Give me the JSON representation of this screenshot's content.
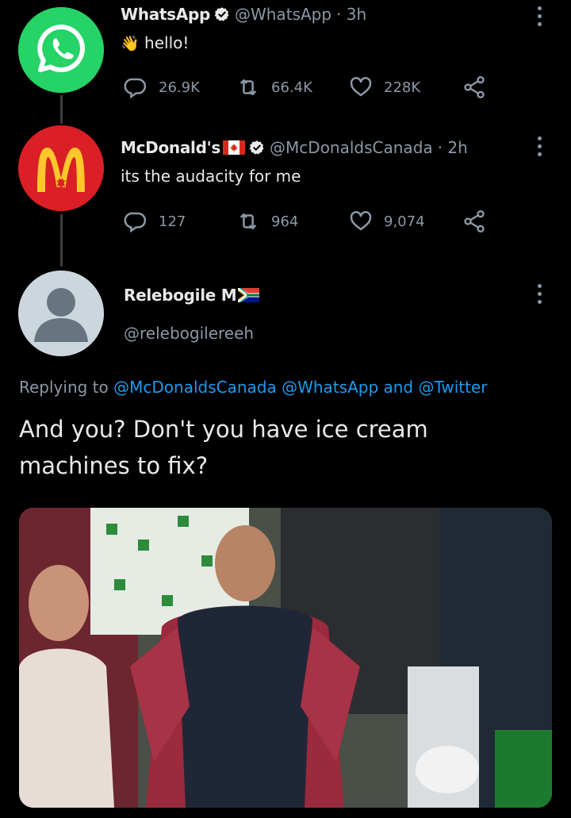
{
  "tweets": [
    {
      "name": "WhatsApp",
      "handle": "@WhatsApp",
      "time": "· 3h",
      "text": "hello!",
      "emoji": "👋",
      "replies": "26.9K",
      "retweets": "66.4K",
      "likes": "228K",
      "avatar_color": "#25d366"
    },
    {
      "name": "McDonald's",
      "handle": "@McDonaldsCanada",
      "time": "· 2h",
      "text": "its the audacity for me",
      "replies": "127",
      "retweets": "964",
      "likes": "9,074",
      "avatar_color": "#da1f26"
    }
  ],
  "reply": {
    "name": "Relebogile M",
    "handle": "@relebogilereeh",
    "replying_prefix": "Replying to ",
    "mention_1": "@McDonaldsCanada",
    "mention_2": "@WhatsApp",
    "and_text": " and ",
    "mention_3": "@Twitter",
    "text": "And you? Don't you have ice cream machines to fix?"
  },
  "colors": {
    "background": "#000000",
    "muted": "#8b98a5",
    "link": "#1d9bf0",
    "verified": "#e7e9ea"
  },
  "icons": [
    "whatsapp-logo-icon",
    "mcdonalds-logo-icon",
    "default-avatar-icon",
    "verified-icon",
    "canada-flag-icon",
    "south-africa-flag-icon",
    "reply-icon",
    "retweet-icon",
    "like-icon",
    "share-icon",
    "more-icon"
  ]
}
